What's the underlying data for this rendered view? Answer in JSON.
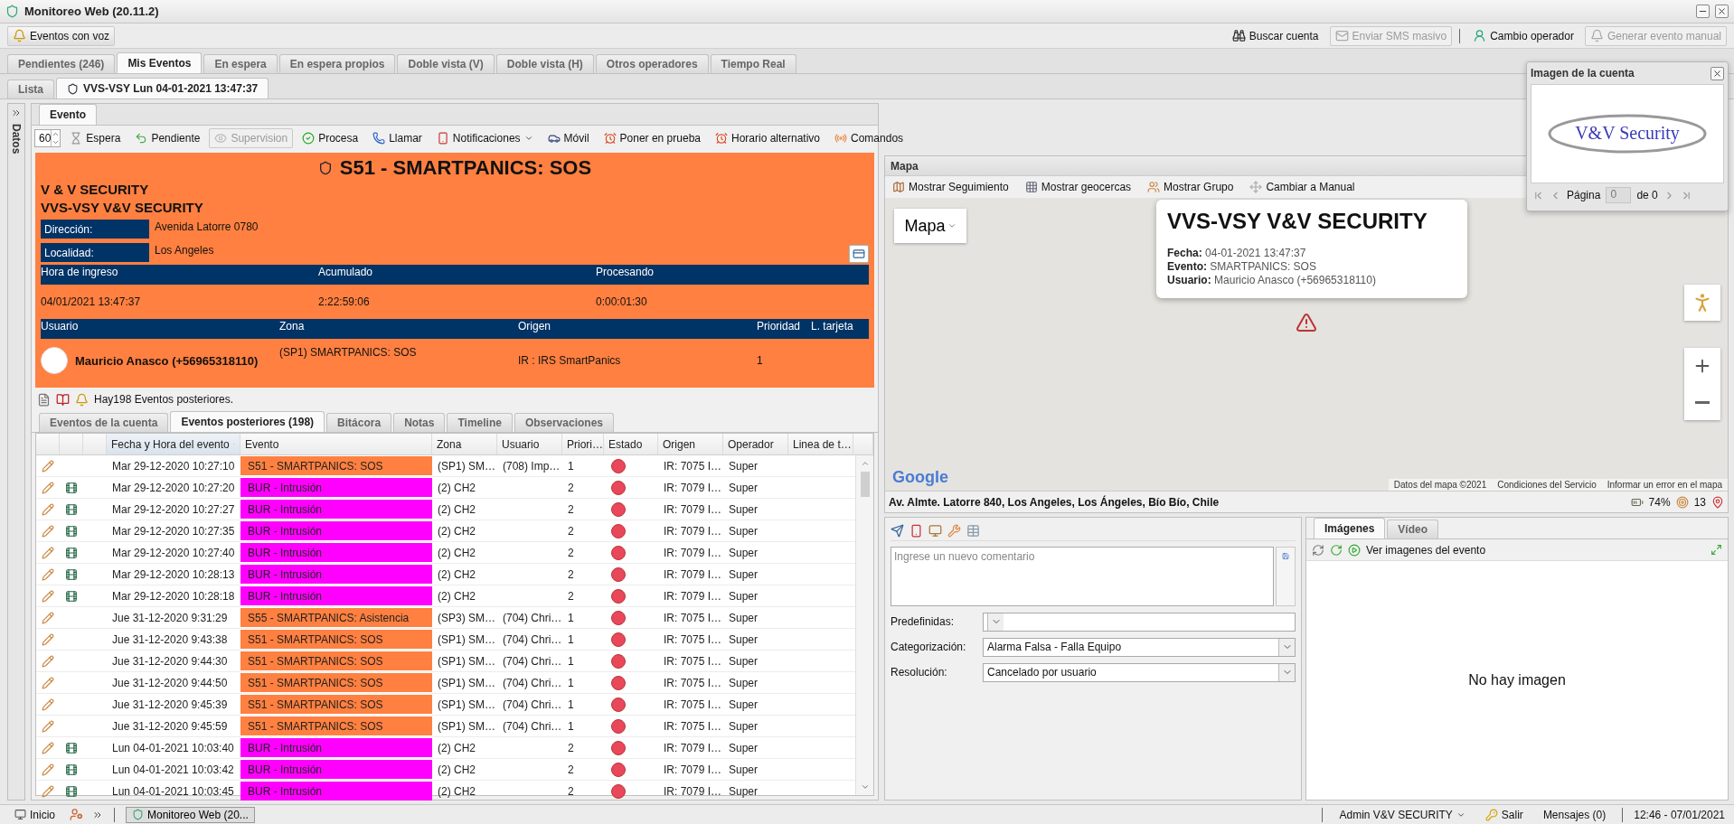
{
  "window": {
    "title": "Monitoreo Web (20.11.2)"
  },
  "toolbar": {
    "voice_button": "Eventos con voz",
    "actions": [
      {
        "label": "Buscar cuenta",
        "disabled": false
      },
      {
        "label": "Enviar SMS masivo",
        "disabled": true
      },
      {
        "label": "Cambio operador",
        "disabled": false
      },
      {
        "label": "Generar evento manual",
        "disabled": true
      }
    ]
  },
  "main_tabs": [
    {
      "label": "Pendientes (246)",
      "selected": false
    },
    {
      "label": "Mis Eventos",
      "selected": true
    },
    {
      "label": "En espera",
      "selected": false
    },
    {
      "label": "En espera propios",
      "selected": false
    },
    {
      "label": "Doble vista (V)",
      "selected": false
    },
    {
      "label": "Doble vista (H)",
      "selected": false
    },
    {
      "label": "Otros operadores",
      "selected": false
    },
    {
      "label": "Tiempo Real",
      "selected": false
    }
  ],
  "sub_tabs": [
    {
      "label": "Lista",
      "selected": false,
      "kind": "plain"
    },
    {
      "label": "VVS-VSY Lun 04-01-2021 13:47:37",
      "selected": true,
      "kind": "sos"
    }
  ],
  "sidebar": {
    "label": "Datos"
  },
  "event_tabs": [
    {
      "label": "Evento",
      "selected": true
    }
  ],
  "event_toolbar": {
    "spinner": "60",
    "buttons": [
      {
        "label": "Espera",
        "disabled": false,
        "menu": false
      },
      {
        "label": "Pendiente",
        "disabled": false,
        "menu": false
      },
      {
        "label": "Supervision",
        "disabled": true,
        "menu": false
      },
      {
        "label": "Procesa",
        "disabled": false,
        "menu": false
      },
      {
        "label": "Llamar",
        "disabled": false,
        "menu": false
      },
      {
        "label": "Notificaciones",
        "disabled": false,
        "menu": true
      },
      {
        "label": "Móvil",
        "disabled": false,
        "menu": false
      },
      {
        "label": "Poner en prueba",
        "disabled": false,
        "menu": false
      },
      {
        "label": "Horario alternativo",
        "disabled": false,
        "menu": false
      },
      {
        "label": "Comandos",
        "disabled": false,
        "menu": false
      }
    ]
  },
  "event": {
    "title": "S51 - SMARTPANICS: SOS",
    "company": "V & V SECURITY",
    "account": "VVS-VSY V&V SECURITY",
    "fields": [
      {
        "label": "Dirección:",
        "value": "Avenida Latorre 0780"
      },
      {
        "label": "Localidad:",
        "value": "Los Angeles"
      }
    ],
    "time_headers": [
      "Hora de ingreso",
      "Acumulado",
      "Procesando"
    ],
    "time_values": [
      "04/01/2021 13:47:37",
      "2:22:59:06",
      "0:00:01:30"
    ],
    "user_headers": [
      "Usuario",
      "Zona",
      "Origen",
      "Prioridad",
      "L. tarjeta"
    ],
    "user": {
      "name": "Mauricio Anasco (+56965318110)",
      "zona": "(SP1) SMARTPANICS: SOS",
      "origen": "IR : IRS SmartPanics",
      "prioridad": "1"
    }
  },
  "actions_text": "Hay198 Eventos posteriores.",
  "detail_tabs": [
    {
      "label": "Eventos de la cuenta",
      "selected": false
    },
    {
      "label": "Eventos posteriores (198)",
      "selected": true
    },
    {
      "label": "Bitácora",
      "selected": false
    },
    {
      "label": "Notas",
      "selected": false
    },
    {
      "label": "Timeline",
      "selected": false
    },
    {
      "label": "Observaciones",
      "selected": false
    }
  ],
  "grid": {
    "columns": [
      {
        "label": "Fecha y Hora del evento",
        "sorted": true
      },
      {
        "label": "Evento",
        "sorted": false
      },
      {
        "label": "Zona",
        "sorted": false
      },
      {
        "label": "Usuario",
        "sorted": false
      },
      {
        "label": "Priori…",
        "sorted": false
      },
      {
        "label": "Estado",
        "sorted": false
      },
      {
        "label": "Origen",
        "sorted": false
      },
      {
        "label": "Operador",
        "sorted": false
      },
      {
        "label": "Linea de t…",
        "sorted": false
      }
    ],
    "rows": [
      {
        "video": false,
        "fecha": "Mar 29-12-2020 10:27:10",
        "evento": "S51 - SMARTPANICS: SOS",
        "color": "#ff8040",
        "zona": "(SP1) SM…",
        "usuario": "(708) Imp…",
        "prioridad": "1",
        "origen": "IR: 7075 I…",
        "operador": "Super"
      },
      {
        "video": true,
        "fecha": "Mar 29-12-2020 10:27:20",
        "evento": "BUR - Intrusión",
        "color": "#ff00ff",
        "zona": "(2) CH2",
        "prioridad": "2",
        "origen": "IR: 7079 I…",
        "operador": "Super"
      },
      {
        "video": true,
        "fecha": "Mar 29-12-2020 10:27:27",
        "evento": "BUR - Intrusión",
        "color": "#ff00ff",
        "zona": "(2) CH2",
        "prioridad": "2",
        "origen": "IR: 7079 I…",
        "operador": "Super"
      },
      {
        "video": true,
        "fecha": "Mar 29-12-2020 10:27:35",
        "evento": "BUR - Intrusión",
        "color": "#ff00ff",
        "zona": "(2) CH2",
        "prioridad": "2",
        "origen": "IR: 7079 I…",
        "operador": "Super"
      },
      {
        "video": true,
        "fecha": "Mar 29-12-2020 10:27:40",
        "evento": "BUR - Intrusión",
        "color": "#ff00ff",
        "zona": "(2) CH2",
        "prioridad": "2",
        "origen": "IR: 7079 I…",
        "operador": "Super"
      },
      {
        "video": true,
        "fecha": "Mar 29-12-2020 10:28:13",
        "evento": "BUR - Intrusión",
        "color": "#ff00ff",
        "zona": "(2) CH2",
        "prioridad": "2",
        "origen": "IR: 7079 I…",
        "operador": "Super"
      },
      {
        "video": true,
        "fecha": "Mar 29-12-2020 10:28:18",
        "evento": "BUR - Intrusión",
        "color": "#ff00ff",
        "zona": "(2) CH2",
        "prioridad": "2",
        "origen": "IR: 7079 I…",
        "operador": "Super"
      },
      {
        "video": false,
        "fecha": "Jue 31-12-2020 9:31:29",
        "evento": "S55 - SMARTPANICS: Asistencia",
        "color": "#ff8040",
        "zona": "(SP3) SM…",
        "usuario": "(704) Chri…",
        "prioridad": "1",
        "origen": "IR: 7075 I…",
        "operador": "Super"
      },
      {
        "video": false,
        "fecha": "Jue 31-12-2020 9:43:38",
        "evento": "S51 - SMARTPANICS: SOS",
        "color": "#ff8040",
        "zona": "(SP1) SM…",
        "usuario": "(704) Chri…",
        "prioridad": "1",
        "origen": "IR: 7075 I…",
        "operador": "Super"
      },
      {
        "video": false,
        "fecha": "Jue 31-12-2020 9:44:30",
        "evento": "S51 - SMARTPANICS: SOS",
        "color": "#ff8040",
        "zona": "(SP1) SM…",
        "usuario": "(704) Chri…",
        "prioridad": "1",
        "origen": "IR: 7075 I…",
        "operador": "Super"
      },
      {
        "video": false,
        "fecha": "Jue 31-12-2020 9:44:50",
        "evento": "S51 - SMARTPANICS: SOS",
        "color": "#ff8040",
        "zona": "(SP1) SM…",
        "usuario": "(704) Chri…",
        "prioridad": "1",
        "origen": "IR: 7075 I…",
        "operador": "Super"
      },
      {
        "video": false,
        "fecha": "Jue 31-12-2020 9:45:39",
        "evento": "S51 - SMARTPANICS: SOS",
        "color": "#ff8040",
        "zona": "(SP1) SM…",
        "usuario": "(704) Chri…",
        "prioridad": "1",
        "origen": "IR: 7075 I…",
        "operador": "Super"
      },
      {
        "video": false,
        "fecha": "Jue 31-12-2020 9:45:59",
        "evento": "S51 - SMARTPANICS: SOS",
        "color": "#ff8040",
        "zona": "(SP1) SM…",
        "usuario": "(704) Chri…",
        "prioridad": "1",
        "origen": "IR: 7075 I…",
        "operador": "Super"
      },
      {
        "video": true,
        "fecha": "Lun 04-01-2021 10:03:40",
        "evento": "BUR - Intrusión",
        "color": "#ff00ff",
        "zona": "(2) CH2",
        "prioridad": "2",
        "origen": "IR: 7079 I…",
        "operador": "Super"
      },
      {
        "video": true,
        "fecha": "Lun 04-01-2021 10:03:42",
        "evento": "BUR - Intrusión",
        "color": "#ff00ff",
        "zona": "(2) CH2",
        "prioridad": "2",
        "origen": "IR: 7079 I…",
        "operador": "Super"
      },
      {
        "video": true,
        "fecha": "Lun 04-01-2021 10:03:45",
        "evento": "BUR - Intrusión",
        "color": "#ff00ff",
        "zona": "(2) CH2",
        "prioridad": "2",
        "origen": "IR: 7079 I…",
        "operador": "Super"
      }
    ]
  },
  "map": {
    "title": "Mapa",
    "toolbar": [
      {
        "label": "Mostrar Seguimiento",
        "disabled": false
      },
      {
        "label": "Mostrar geocercas",
        "disabled": false
      },
      {
        "label": "Mostrar Grupo",
        "disabled": false
      },
      {
        "label": "Cambiar a Manual",
        "disabled": false
      }
    ],
    "map_type": "Mapa",
    "popup": {
      "title": "VVS-VSY V&V SECURITY",
      "lines": [
        {
          "label": "Fecha:",
          "value": "04-01-2021 13:47:37"
        },
        {
          "label": "Evento:",
          "value": "SMARTPANICS: SOS"
        },
        {
          "label": "Usuario:",
          "value": "Mauricio Anasco (+56965318110)"
        }
      ]
    },
    "logo": "Google",
    "attribution": [
      "Datos del mapa ©2021",
      "Condiciones del Servicio",
      "Informar un error en el mapa"
    ],
    "address": "Av. Almte. Latorre 840, Los Angeles, Los Ángeles, Bío Bío, Chile",
    "battery": "74%",
    "satellites": "13"
  },
  "account_image": {
    "title": "Imagen de la cuenta",
    "logo_text": "V&V Security",
    "pager_label": "Página",
    "page": "0",
    "page_total": "de 0"
  },
  "comment": {
    "placeholder": "Ingrese un nuevo comentario",
    "fields": [
      {
        "label": "Predefinidas:"
      },
      {
        "label": "Categorización:",
        "value": "Alarma Falsa - Falla Equipo"
      },
      {
        "label": "Resolución:",
        "value": "Cancelado por usuario"
      }
    ]
  },
  "images": {
    "tabs": [
      {
        "label": "Imágenes",
        "selected": true
      },
      {
        "label": "Vídeo",
        "selected": false
      }
    ],
    "link": "Ver imagenes del evento",
    "empty": "No hay imagen"
  },
  "taskbar": {
    "start": "Inicio",
    "window": "Monitoreo Web (20...",
    "user": "Admin V&V SECURITY",
    "logout": "Salir",
    "messages": "Mensajes (0)",
    "clock": "12:46 - 07/01/2021"
  }
}
